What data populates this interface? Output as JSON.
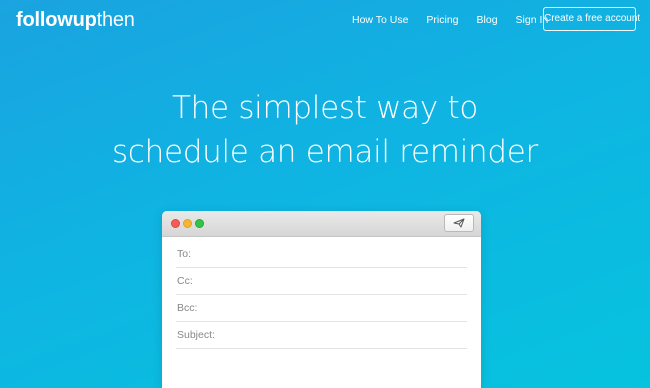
{
  "brand": {
    "logo_part1": "followup",
    "logo_part2": "then"
  },
  "nav": {
    "items": [
      "How To Use",
      "Pricing",
      "Blog",
      "Sign In"
    ],
    "cta_label": "Create a free account"
  },
  "hero": {
    "line1": "The simplest way to",
    "line2": "schedule an email reminder"
  },
  "compose": {
    "send_icon": "paper-plane-icon",
    "fields": [
      {
        "label": "To:"
      },
      {
        "label": "Cc:"
      },
      {
        "label": "Bcc:"
      },
      {
        "label": "Subject:"
      }
    ]
  },
  "colors": {
    "background_start": "#1aa3e0",
    "background_end": "#06c3de",
    "window_close": "#f45d57",
    "window_minimize": "#f5b731",
    "window_zoom": "#35c44a"
  }
}
